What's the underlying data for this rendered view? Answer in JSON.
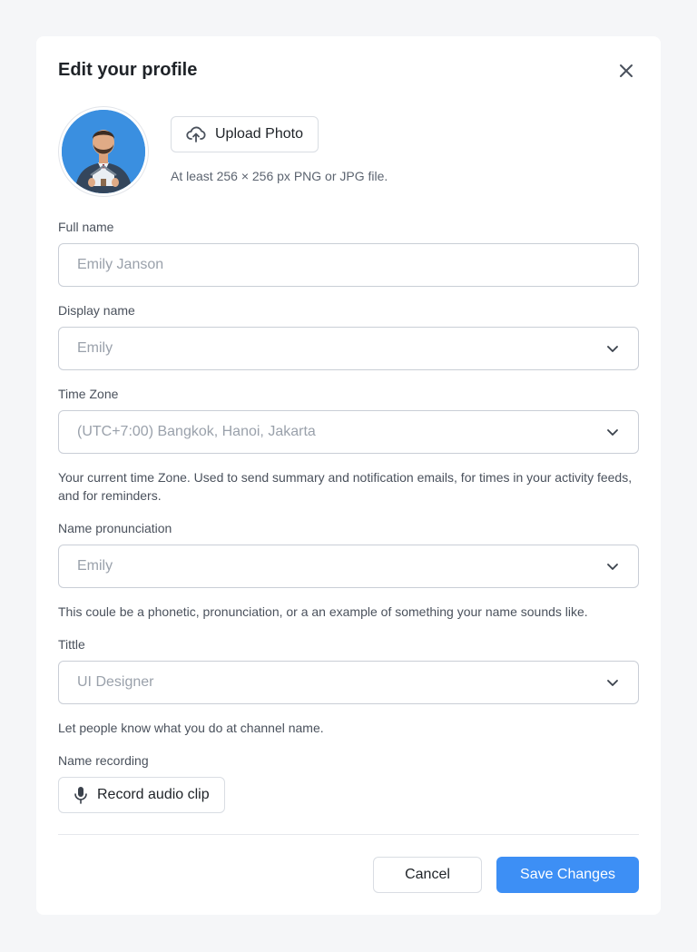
{
  "dialog": {
    "title": "Edit your profile"
  },
  "photo": {
    "upload_label": "Upload Photo",
    "hint": "At least 256 × 256 px PNG or JPG file."
  },
  "fields": {
    "full_name": {
      "label": "Full name",
      "placeholder": "Emily Janson"
    },
    "display_name": {
      "label": "Display name",
      "value": "Emily"
    },
    "time_zone": {
      "label": "Time Zone",
      "value": "(UTC+7:00) Bangkok, Hanoi, Jakarta",
      "help": "Your current time Zone. Used to send summary and notification emails, for times in your activity feeds, and for reminders."
    },
    "name_pronunciation": {
      "label": "Name pronunciation",
      "value": "Emily",
      "help": "This coule be a phonetic, pronunciation, or a an example of something your name sounds like."
    },
    "title": {
      "label": "Tittle",
      "value": "UI Designer",
      "help": "Let people know what you do at channel name."
    },
    "name_recording": {
      "label": "Name recording",
      "button_label": "Record audio clip"
    }
  },
  "actions": {
    "cancel": "Cancel",
    "save": "Save Changes"
  },
  "colors": {
    "accent": "#3d8ff5",
    "avatar_bg": "#3a8fe0",
    "page_bg": "#f5f6f8"
  },
  "icons": {
    "close": "close-icon",
    "upload": "cloud-upload-icon",
    "chevron": "chevron-down-icon",
    "microphone": "microphone-icon"
  }
}
